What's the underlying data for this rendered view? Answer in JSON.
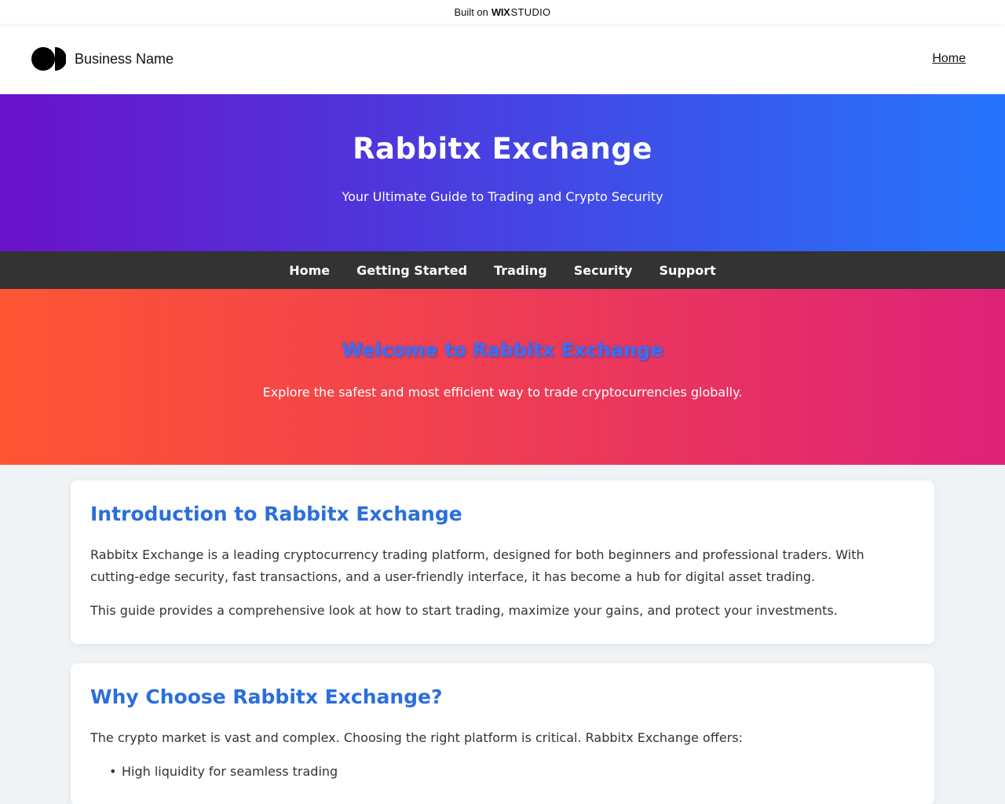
{
  "built_bar": {
    "prefix": "Built on",
    "brand_bold": "WIX",
    "brand_light": "STUDIO"
  },
  "header": {
    "business_name": "Business Name",
    "home_link": "Home"
  },
  "hero": {
    "title": "Rabbitx Exchange",
    "subtitle": "Your Ultimate Guide to Trading and Crypto Security"
  },
  "nav": {
    "items": [
      {
        "label": "Home"
      },
      {
        "label": "Getting Started"
      },
      {
        "label": "Trading"
      },
      {
        "label": "Security"
      },
      {
        "label": "Support"
      }
    ]
  },
  "welcome": {
    "title": "Welcome to Rabbitx Exchange",
    "text": "Explore the safest and most efficient way to trade cryptocurrencies globally."
  },
  "sections": [
    {
      "title": "Introduction to Rabbitx Exchange",
      "paragraphs": [
        "Rabbitx Exchange is a leading cryptocurrency trading platform, designed for both beginners and professional traders. With cutting-edge security, fast transactions, and a user-friendly interface, it has become a hub for digital asset trading.",
        "This guide provides a comprehensive look at how to start trading, maximize your gains, and protect your investments."
      ]
    },
    {
      "title": "Why Choose Rabbitx Exchange?",
      "paragraphs": [
        "The crypto market is vast and complex. Choosing the right platform is critical. Rabbitx Exchange offers:"
      ],
      "list": [
        "High liquidity for seamless trading"
      ]
    }
  ],
  "colors": {
    "hero_start": "#6a12cb",
    "hero_end": "#2575fc",
    "nav_bg": "#333333",
    "welcome_start": "#ff5533",
    "welcome_end": "#de2278",
    "heading_blue": "#2a6fdb",
    "page_bg": "#f0f3f5"
  }
}
